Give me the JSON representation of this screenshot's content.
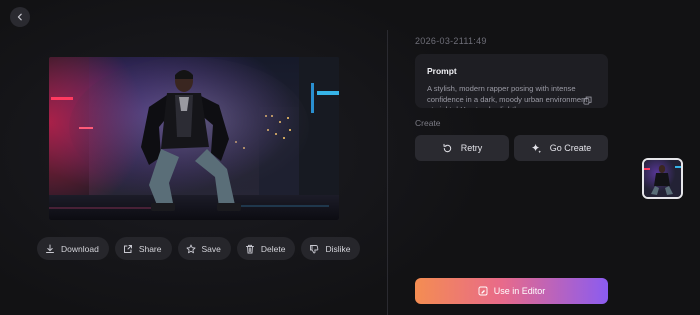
{
  "header": {
    "back_icon": "chevron-left-icon"
  },
  "image": {
    "alt": "",
    "accent_colors": [
      "#e0204a",
      "#7a44d8",
      "#36b4e8"
    ]
  },
  "actions": [
    {
      "label": "Download",
      "icon": "download-icon"
    },
    {
      "label": "Share",
      "icon": "share-icon"
    },
    {
      "label": "Save",
      "icon": "star-icon"
    },
    {
      "label": "Delete",
      "icon": "trash-icon"
    },
    {
      "label": "Dislike",
      "icon": "thumbs-down-icon"
    }
  ],
  "details": {
    "timestamp": "2026-03-2111:49",
    "prompt_title": "Prompt",
    "prompt_text": "A stylish, modern rapper posing with intense confidence in a dark, moody urban environment at night. | He stands slightly",
    "create_label": "Create",
    "retry_label": "Retry",
    "go_create_label": "Go Create",
    "editor_label": "Use in Editor"
  },
  "colors": {
    "background": "#121214",
    "button_bg": "#26262b",
    "gradient_start": "#f48d52",
    "gradient_end": "#8b5cf0"
  }
}
